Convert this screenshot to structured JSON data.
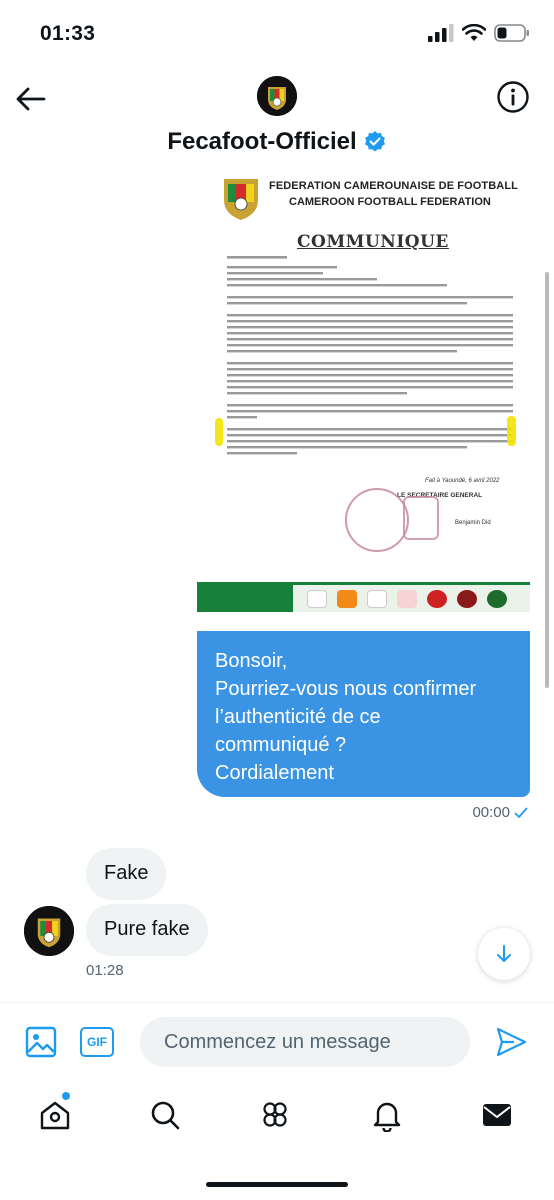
{
  "status_bar": {
    "time": "01:33"
  },
  "header": {
    "title": "Fecafoot-Officiel",
    "verified": true
  },
  "attachment": {
    "doc_header_line1": "FEDERATION CAMEROUNAISE DE FOOTBALL",
    "doc_header_line2": "CAMEROON FOOTBALL FEDERATION",
    "doc_title": "COMMUNIQUE",
    "doc_signature_date": "Fait à Yaoundé, 6 avril 2022",
    "doc_signature_title": "LE SECRETAIRE GENERAL",
    "doc_signature_name": "Benjamin Did"
  },
  "messages": {
    "sent": {
      "lines": [
        "Bonsoir,",
        "Pourriez-vous nous confirmer",
        "l’authenticité de ce",
        "communiqué ?",
        "Cordialement"
      ],
      "time": "00:00"
    },
    "received": {
      "bubbles": [
        "Fake",
        "Pure fake"
      ],
      "time": "01:28"
    }
  },
  "composer": {
    "gif_label": "GIF",
    "placeholder": "Commencez un message"
  },
  "colors": {
    "accent": "#1d9bf0",
    "sent_bubble": "#3a94e3",
    "received_bubble": "#eff3f4"
  },
  "icons": {
    "back": "arrow-left-icon",
    "info": "info-icon",
    "verified": "verified-badge-icon",
    "image": "image-icon",
    "send": "send-icon",
    "scroll_down": "arrow-down-icon",
    "tabs": [
      "home-icon",
      "search-icon",
      "communities-icon",
      "bell-icon",
      "mail-icon"
    ]
  }
}
